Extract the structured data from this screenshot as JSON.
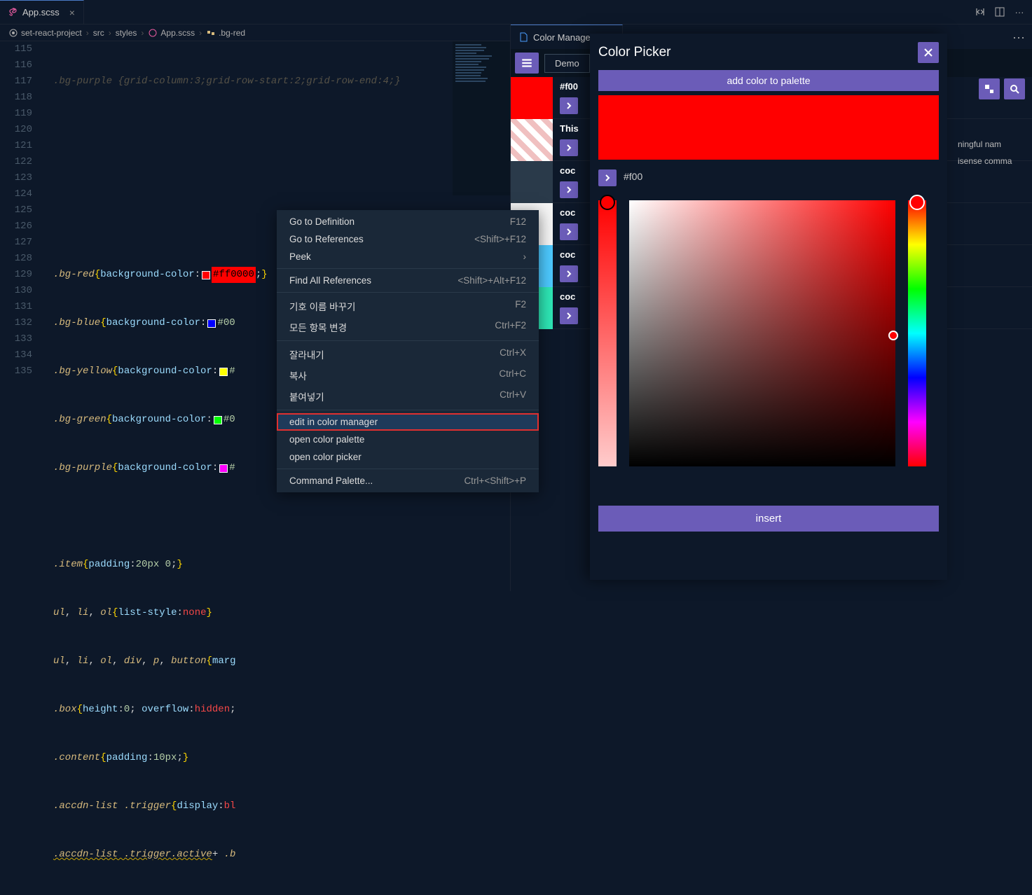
{
  "tabs": {
    "editor": {
      "label": "App.scss"
    },
    "panel": {
      "label": "Color Manager"
    }
  },
  "breadcrumb": {
    "root": "set-react-project",
    "p1": "src",
    "p2": "styles",
    "p3": "App.scss",
    "p4": ".bg-red"
  },
  "gutter": [
    "115",
    "116",
    "117",
    "118",
    "119",
    "120",
    "121",
    "122",
    "123",
    "124",
    "125",
    "126",
    "127",
    "128",
    "129",
    "130",
    "131",
    "132",
    "133",
    "134",
    "135"
  ],
  "code": {
    "l115": ".bg-purple {grid-column:3;grid-row-start:2;grid-row-end:4;}",
    "l123_sel": ".bg-red",
    "l123_prop": "background-color",
    "l123_hex": "#ff0000",
    "l124_sel": ".bg-blue",
    "l124_prop": "background-color",
    "l124_hex": "#00",
    "l125_sel": ".bg-yellow",
    "l125_prop": "background-color",
    "l125_hex": "#",
    "l126_sel": ".bg-green",
    "l126_prop": "background-color",
    "l126_hex": "#0",
    "l127_sel": ".bg-purple",
    "l127_prop": "background-color",
    "l127_hex": "#",
    "l129": ".item {padding:20px 0;}",
    "l130": "ul, li, ol {list-style:none}",
    "l131": "ul, li, ol, div, p, button {marg",
    "l132": ".box {height:0; overflow:hidden;",
    "l133": ".content { padding:10px;}",
    "l134": ".accdn-list .trigger {display:bl",
    "l135": ".accdn-list .trigger.active + .b"
  },
  "contextMenu": {
    "goToDef": "Go to Definition",
    "goToDefKey": "F12",
    "goToRef": "Go to References",
    "goToRefKey": "<Shift>+F12",
    "peek": "Peek",
    "findAll": "Find All References",
    "findAllKey": "<Shift>+Alt+F12",
    "renameSym": "기호 이름 바꾸기",
    "renameSymKey": "F2",
    "changeAll": "모든 항목 변경",
    "changeAllKey": "Ctrl+F2",
    "cut": "잘라내기",
    "cutKey": "Ctrl+X",
    "copy": "복사",
    "copyKey": "Ctrl+C",
    "paste": "붙여넣기",
    "pasteKey": "Ctrl+V",
    "editCM": "edit in color manager",
    "openPalette": "open color palette",
    "openPicker": "open color picker",
    "cmdPalette": "Command Palette...",
    "cmdPaletteKey": "Ctrl+<Shift>+P"
  },
  "colorManager": {
    "demoBtn": "Demo",
    "rows": [
      {
        "name": "#f00",
        "swatch": "#ff0000"
      },
      {
        "name": "This",
        "swatch": "stripe"
      },
      {
        "name": "coc",
        "swatch": "#2a3a4a"
      },
      {
        "name": "coc",
        "swatch": "#f5f5f5"
      },
      {
        "name": "coc",
        "swatch": "#4dc9ff"
      },
      {
        "name": "coc",
        "swatch": "#2ee6b5"
      }
    ],
    "sideText1": "ningful nam",
    "sideText2": "isense comma"
  },
  "picker": {
    "title": "Color Picker",
    "addBtn": "add color to palette",
    "hex": "#f00",
    "insertBtn": "insert"
  }
}
